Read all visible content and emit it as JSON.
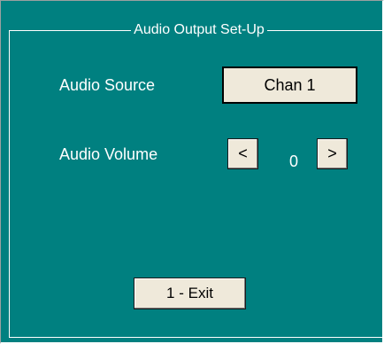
{
  "groupbox": {
    "title": "Audio Output Set-Up"
  },
  "audio_source": {
    "label": "Audio Source",
    "value": "Chan 1"
  },
  "audio_volume": {
    "label": "Audio Volume",
    "decrease_label": "<",
    "value": "0",
    "increase_label": ">"
  },
  "exit_button": {
    "label": "1 - Exit"
  },
  "colors": {
    "background": "#008080",
    "button_face": "#efe9da",
    "text": "#ffffff"
  }
}
